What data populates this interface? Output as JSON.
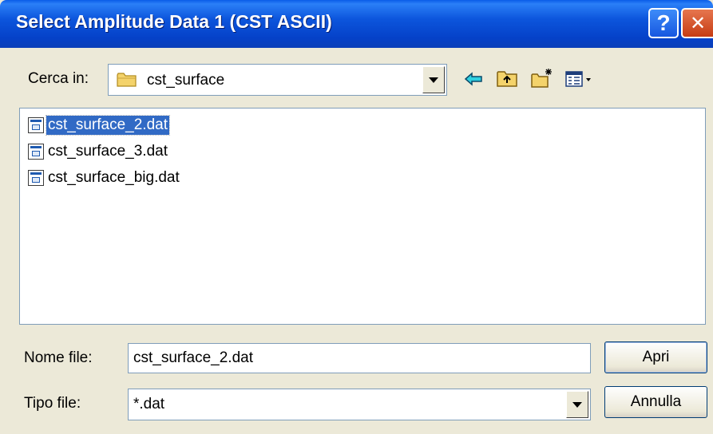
{
  "window": {
    "title": "Select Amplitude Data 1 (CST ASCII)",
    "help_label": "?",
    "close_label": "✕"
  },
  "lookin": {
    "label": "Cerca in:",
    "value": "cst_surface",
    "icon": "folder-icon"
  },
  "toolbar": {
    "icons": [
      "back-arrow-icon",
      "up-folder-icon",
      "new-folder-icon",
      "view-menu-icon"
    ]
  },
  "files": [
    {
      "name": "cst_surface_2.dat",
      "selected": true
    },
    {
      "name": "cst_surface_3.dat",
      "selected": false
    },
    {
      "name": "cst_surface_big.dat",
      "selected": false
    }
  ],
  "filename": {
    "label": "Nome file:",
    "value": "cst_surface_2.dat"
  },
  "filetype": {
    "label": "Tipo file:",
    "value": "*.dat"
  },
  "buttons": {
    "open": "Apri",
    "cancel": "Annulla"
  },
  "colors": {
    "title_bar": "#0c55dc",
    "selection": "#316ac5",
    "dialog_bg": "#ece9d8"
  }
}
